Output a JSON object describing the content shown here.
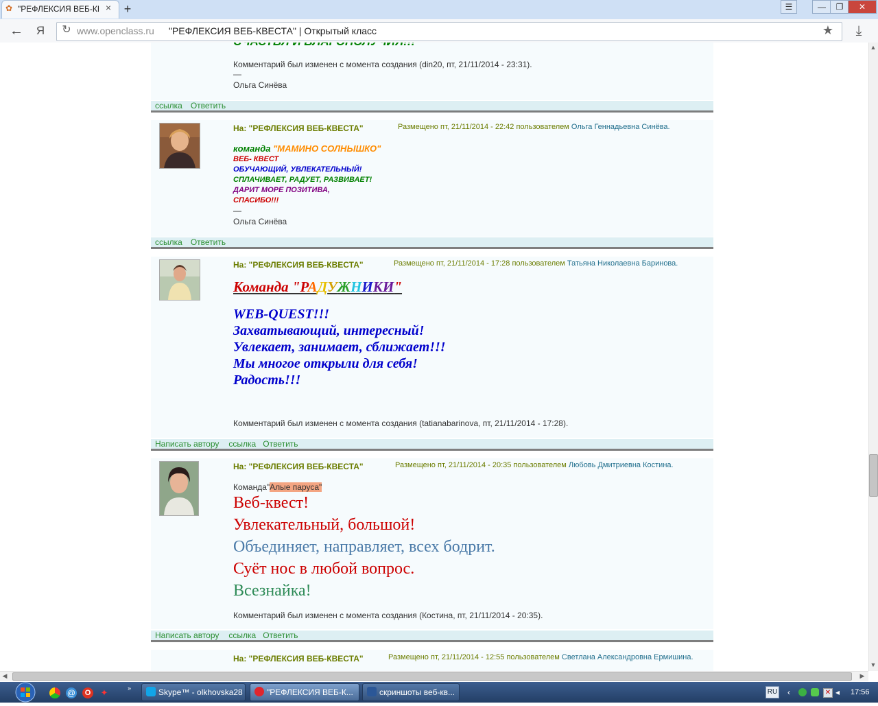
{
  "browser": {
    "tab_title": "\"РЕФЛЕКСИЯ ВЕБ-КВЕ",
    "tab_close": "×",
    "new_tab": "+",
    "url_host": "www.openclass.ru",
    "url_title": "\"РЕФЛЕКСИЯ ВЕБ-КВЕСТА\" | Открытый класс",
    "back": "←",
    "ya": "Я",
    "reload": "↻",
    "star": "★",
    "download": "⤓",
    "window_buttons": {
      "menu": "☰",
      "min": "—",
      "max": "❐",
      "close": "✕"
    },
    "scroll": {
      "up": "▲",
      "down": "▼",
      "left": "◀",
      "right": "▶"
    }
  },
  "top_fragment": {
    "partial_line": "СЧАСТЬЯ И БЛАГОПОЛУЧИЯ!!!",
    "edited": "Комментарий был изменен с момента создания (din20, пт, 21/11/2014 - 23:31).",
    "dash": "—",
    "signature": "Ольга Синёва",
    "links": [
      "ссылка",
      "Ответить"
    ]
  },
  "comments": [
    {
      "subject": "На: \"РЕФЛЕКСИЯ ВЕБ-КВЕСТА\"",
      "meta_prefix": "Размещено пт, 21/11/2014 - 22:42 пользователем",
      "author": "Ольга Геннадьевна Синёва.",
      "body": {
        "team_label": "команда",
        "team_name": "\"МАМИНО СОЛНЫШКО\"",
        "lines": [
          "ВЕБ- КВЕСТ",
          "ОБУЧАЮЩИЙ, УВЛЕКАТЕЛЬНЫЙ!",
          "СПЛАЧИВАЕТ, РАДУЕТ, РАЗВИВАЕТ!",
          "ДАРИТ МОРЕ ПОЗИТИВА,",
          "СПАСИБО!!!"
        ],
        "dash": "—",
        "signature": "Ольга Синёва"
      },
      "links": [
        "ссылка",
        "Ответить"
      ]
    },
    {
      "subject": "На: \"РЕФЛЕКСИЯ ВЕБ-КВЕСТА\"",
      "meta_prefix": "Размещено пт, 21/11/2014 - 17:28 пользователем",
      "author": "Татьяна Николаевна Баринова.",
      "body": {
        "title_parts": [
          "Команда \"",
          "Р",
          "А",
          "Д",
          "У",
          "Ж",
          "Н",
          "И",
          "К",
          "И",
          "\""
        ],
        "lines": [
          "WEB-QUEST!!!",
          "Захватывающий, интересный!",
          "Увлекает, занимает, сближает!!!",
          "Мы многое открыли для себя!",
          "Радость!!!"
        ],
        "edited": "Комментарий был изменен с момента создания (tatianabarinova, пт, 21/11/2014 - 17:28)."
      },
      "links": [
        "Написать автору",
        "ссылка",
        "Ответить"
      ]
    },
    {
      "subject": "На: \"РЕФЛЕКСИЯ ВЕБ-КВЕСТА\"",
      "meta_prefix": "Размещено пт, 21/11/2014 - 20:35 пользователем",
      "author": "Любовь Дмитриевна Костина.",
      "body": {
        "team_label": "Команда\"",
        "team_name": "Алые паруса\"",
        "lines": [
          "Веб-квест!",
          "Увлекательный, большой!",
          "Объединяет, направляет, всех бодрит.",
          "Суёт нос в любой вопрос.",
          "Всезнайка!"
        ],
        "edited": "Комментарий был изменен с момента создания (Костина, пт, 21/11/2014 - 20:35)."
      },
      "links": [
        "Написать автору",
        "ссылка",
        "Ответить"
      ]
    },
    {
      "subject": "На: \"РЕФЛЕКСИЯ ВЕБ-КВЕСТА\"",
      "meta_prefix": "Размещено пт, 21/11/2014 - 12:55 пользователем",
      "author": "Светлана Александровна Ермишина."
    }
  ],
  "colors": {
    "green_text": "#008000",
    "orange": "#ff8c00",
    "red": "#cc0000",
    "blue": "#0000cc",
    "purple": "#800080",
    "steel": "#4a7aa8",
    "sea_green": "#2e8b57",
    "highlight": "#f4a582"
  },
  "taskbar": {
    "items": [
      "Skype™ - olkhovska28",
      "\"РЕФЛЕКСИЯ ВЕБ-К...",
      "скриншоты веб-кв..."
    ],
    "lang": "RU",
    "clock": "17:56"
  }
}
